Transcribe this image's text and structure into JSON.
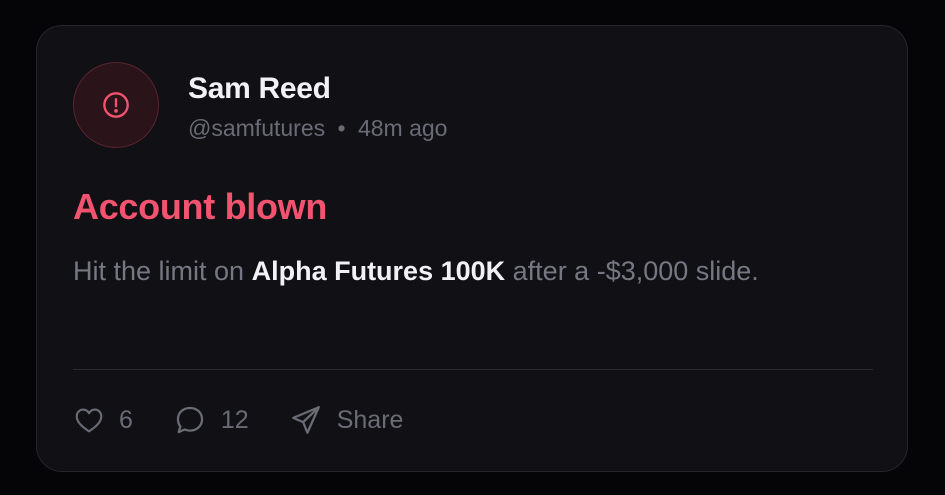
{
  "post": {
    "author_name": "Sam Reed",
    "handle": "@samfutures",
    "separator": "•",
    "time_ago": "48m ago",
    "title": "Account blown",
    "body_prefix": "Hit the limit on",
    "body_highlight": "Alpha Futures 100K",
    "body_suffix": "after a -$3,000 slide.",
    "avatar_icon": "alert-circle-icon"
  },
  "actions": {
    "likes": "6",
    "replies": "12",
    "share_label": "Share"
  },
  "colors": {
    "title_accent": "#f25470",
    "avatar_bg": "#2a1319",
    "card_bg": "#101015"
  }
}
